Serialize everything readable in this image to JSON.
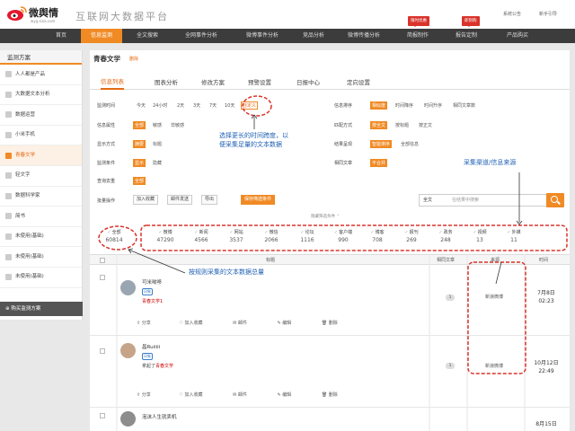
{
  "header": {
    "brand": "微舆情",
    "brand_url": "wyq.sina.com",
    "slogan": "互联网大数据平台",
    "links": [
      "系统公告",
      "新手引导"
    ],
    "badges": [
      "限时优惠",
      "即刻购"
    ]
  },
  "nav": {
    "items": [
      "首页",
      "信息监测",
      "全文搜索",
      "全网事件分析",
      "微博事件分析",
      "竞品分析",
      "微博传播分析",
      "简报制作",
      "报告定制",
      "产品购买"
    ],
    "active_index": 1
  },
  "sidebar": {
    "title": "监测方案",
    "items": [
      "人人都是产品",
      "大数据文本分析",
      "数据运营",
      "小米手机",
      "青春文学",
      "轻文字",
      "数据科学家",
      "简书",
      "未使用(基础)",
      "未使用(基础)",
      "未使用(基础)"
    ],
    "active_index": 4,
    "buy_label": "购买监测方案"
  },
  "main": {
    "title": "青春文学",
    "title_action": "删除",
    "tabs": [
      "信息列表",
      "图表分析",
      "修改方案",
      "预警设置",
      "日报中心",
      "定向设置"
    ],
    "active_tab": 0
  },
  "filters": {
    "time": {
      "label": "监测时间",
      "options": [
        "今天",
        "24小时",
        "2天",
        "3天",
        "7天",
        "10天"
      ],
      "custom": "自定义"
    },
    "attr": {
      "label": "信息属性",
      "options": [
        "全部",
        "敏感",
        "非敏感"
      ]
    },
    "display": {
      "label": "显示方式",
      "options": [
        "摘要",
        "标题"
      ]
    },
    "condition": {
      "label": "监测条件",
      "options": [
        "显示",
        "隐藏"
      ]
    },
    "dedupe": {
      "label": "查询去重",
      "options": [
        "全部"
      ]
    },
    "sort": {
      "label": "信息排序",
      "options": [
        "相似度",
        "时间降序",
        "时间升序",
        "相同文章数"
      ]
    },
    "match": {
      "label": "匹配方式",
      "options": [
        "按全文",
        "按标题",
        "按正文"
      ]
    },
    "result": {
      "label": "结果呈现",
      "options": [
        "智能排序",
        "全部信息"
      ]
    },
    "similar": {
      "label": "相同文章",
      "options": [
        "不合并"
      ]
    },
    "batch": {
      "label": "批量操作",
      "buttons": [
        "加入收藏",
        "邮件发送",
        "导出"
      ],
      "save_filter": "保存筛选条件"
    },
    "search_scope": "全文",
    "search_placeholder": "在结果中搜索",
    "hidden_filters": "隐藏筛选条件"
  },
  "counts": [
    {
      "label": "全部",
      "value": "60814"
    },
    {
      "label": "微博",
      "value": "47290"
    },
    {
      "label": "新闻",
      "value": "4566"
    },
    {
      "label": "网站",
      "value": "3537"
    },
    {
      "label": "微信",
      "value": "2066"
    },
    {
      "label": "论坛",
      "value": "1116"
    },
    {
      "label": "客户端",
      "value": "990"
    },
    {
      "label": "博客",
      "value": "708"
    },
    {
      "label": "报刊",
      "value": "269"
    },
    {
      "label": "政务",
      "value": "248"
    },
    {
      "label": "视频",
      "value": "13"
    },
    {
      "label": "外媒",
      "value": "11"
    }
  ],
  "table": {
    "headers": [
      "标题",
      "相同文章",
      "来源",
      "时间"
    ],
    "rows": [
      {
        "user": "可米呦哆",
        "badge": "印象",
        "text": "青春文学1",
        "text_prefix": "",
        "similar": "1",
        "source": "新浪微博",
        "date": "7月8日",
        "time": "02:23"
      },
      {
        "user": "昌Ruiiiii",
        "badge": "印象",
        "text": "青春文学",
        "text_prefix": "拿起了",
        "similar": "1",
        "source": "新浪微博",
        "date": "10月12日",
        "time": "22:49"
      },
      {
        "user": "泡沫人生就卖机",
        "badge": "",
        "text": "",
        "text_prefix": "",
        "similar": "",
        "source": "",
        "date": "8月15日",
        "time": ""
      }
    ],
    "actions": [
      "分享",
      "加入收藏",
      "邮件",
      "编辑",
      "删除"
    ]
  },
  "annotations": {
    "time_span": [
      "选择更长的时间跨度，以",
      "便采集足量的文本数据"
    ],
    "channels": "采集渠道/信息来源",
    "total": "按规则采集的文本数据总量"
  },
  "colors": {
    "accent": "#f08a24",
    "annotation": "#1e5fb4",
    "annotation_outline": "#d9332b",
    "nav_bg": "#3c3c3c"
  }
}
